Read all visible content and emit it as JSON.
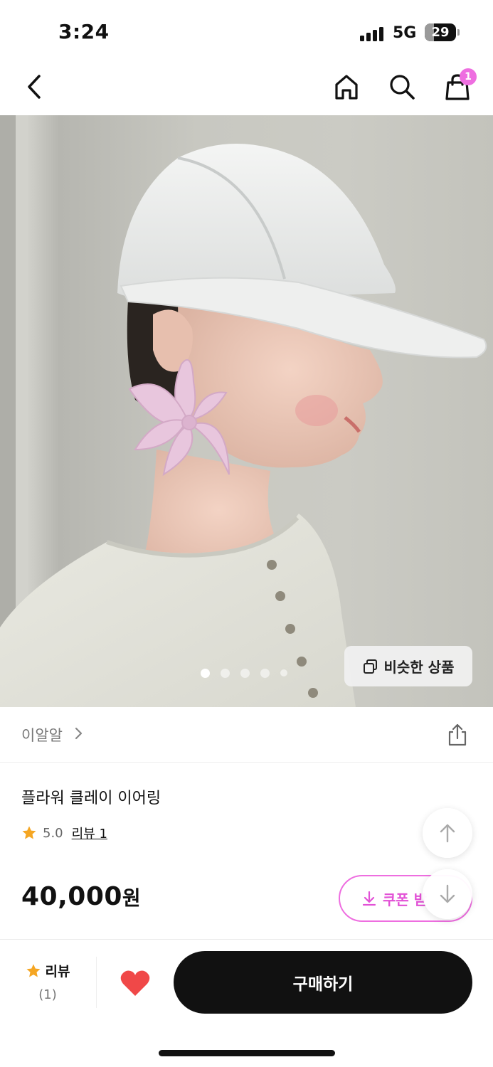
{
  "status_bar": {
    "time": "3:24",
    "network": "5G",
    "battery": "29",
    "battery_level": 0.29
  },
  "nav": {
    "back_icon": "chevron-left-icon",
    "home_icon": "home-icon",
    "search_icon": "search-icon",
    "cart_icon": "shopping-bag-icon",
    "cart_badge": "1"
  },
  "hero": {
    "slide_count": 5,
    "active_slide": 1,
    "similar_button_label": "비슷한 상품"
  },
  "brand": {
    "name": "이알알"
  },
  "product": {
    "title": "플라워 클레이 이어링",
    "rating": "5.0",
    "review_link": "리뷰 1",
    "price": "40,000",
    "price_unit": "원",
    "coupon_label": "쿠폰 받"
  },
  "bottom_bar": {
    "review_label": "리뷰",
    "review_count": "(1)",
    "buy_label": "구매하기"
  },
  "colors": {
    "accent_pink": "#ee6ee0",
    "heart_red": "#f04848",
    "star_orange": "#f5a623",
    "primary_black": "#111111"
  }
}
